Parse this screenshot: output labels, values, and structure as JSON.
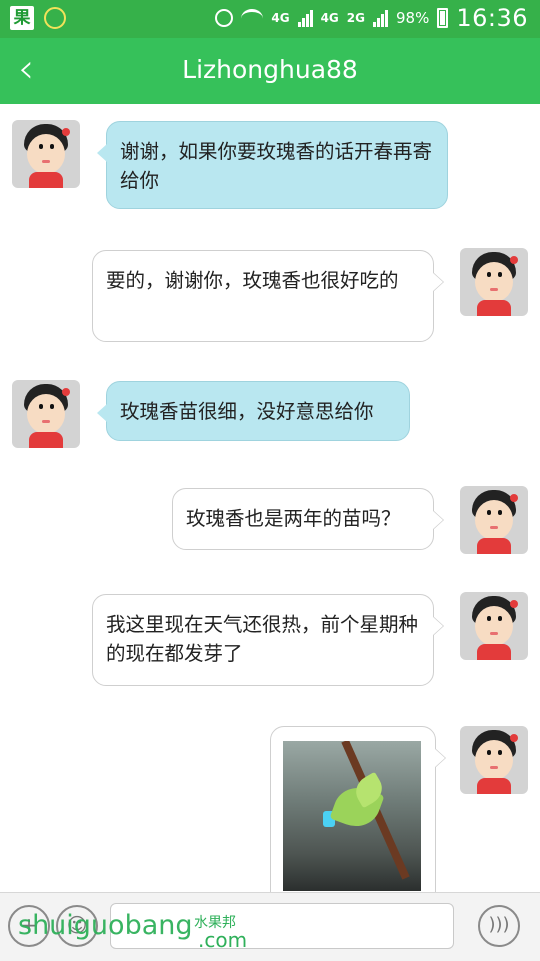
{
  "status_bar": {
    "app_icon_text": "果",
    "network_4g": "4G",
    "network_4g_small": "4G",
    "network_2g": "2G",
    "battery": "98%",
    "time": "16:36"
  },
  "header": {
    "back_icon": "chevron-left-icon",
    "title": "Lizhonghua88"
  },
  "messages": [
    {
      "side": "in",
      "text": "谢谢，如果你要玫瑰香的话开春再寄给你"
    },
    {
      "side": "out",
      "text": "要的，谢谢你，玫瑰香也很好吃的"
    },
    {
      "side": "in",
      "text": "玫瑰香苗很细，没好意思给你"
    },
    {
      "side": "out",
      "text": "玫瑰香也是两年的苗吗？"
    },
    {
      "side": "out",
      "text": "我这里现在天气还很热，前个星期种的现在都发芽了"
    },
    {
      "side": "out",
      "type": "image",
      "alt": "sprouting grapevine photo"
    }
  ],
  "input_bar": {
    "text_value": "",
    "voice_icon": "voice-icon",
    "emoji_icon": "emoji-icon",
    "plus_icon": "plus-icon"
  },
  "watermark": {
    "main": "shuiguobang",
    "cn": "水果邦",
    "suffix": ".com"
  },
  "colors": {
    "brand_green": "#36c15a",
    "incoming_bubble": "#b9e7f0",
    "outgoing_bubble": "#ffffff"
  }
}
